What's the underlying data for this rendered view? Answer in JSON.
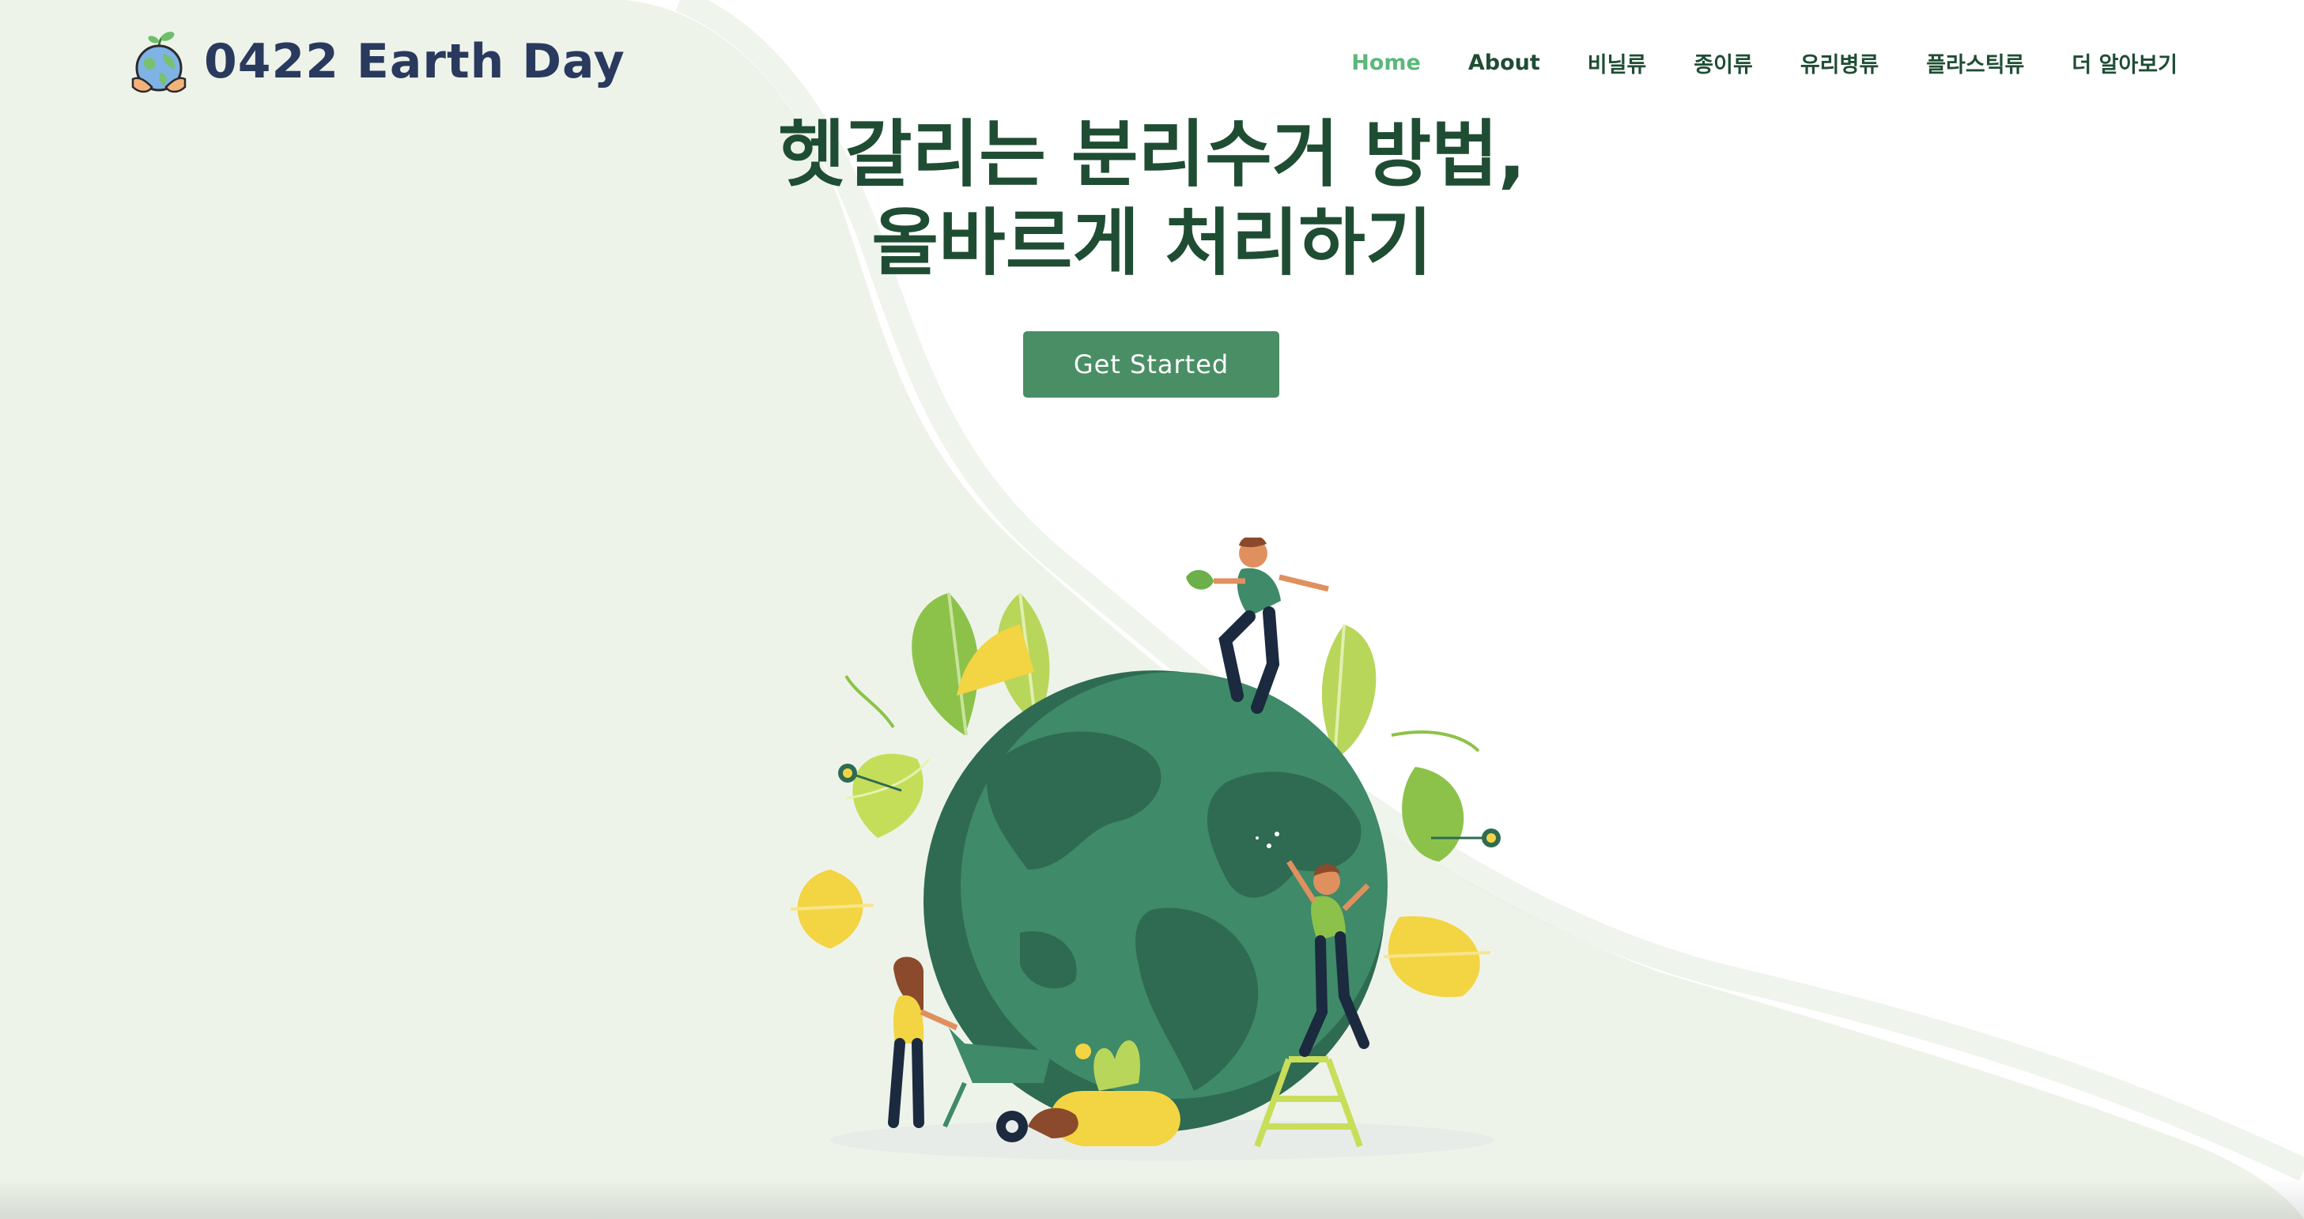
{
  "header": {
    "brand": "0422 Earth Day",
    "nav": [
      {
        "label": "Home",
        "active": true
      },
      {
        "label": "About",
        "active": false
      },
      {
        "label": "비닐류",
        "active": false
      },
      {
        "label": "종이류",
        "active": false
      },
      {
        "label": "유리병류",
        "active": false
      },
      {
        "label": "플라스틱류",
        "active": false
      },
      {
        "label": "더 알아보기",
        "active": false
      }
    ]
  },
  "hero": {
    "title_line1": "헷갈리는 분리수거 방법,",
    "title_line2": "올바르게 처리하기",
    "cta_label": "Get Started"
  },
  "colors": {
    "primary_dark": "#1f4d33",
    "accent_green": "#5cb77a",
    "button": "#4a8e66",
    "brand_text": "#2a3a5e",
    "background_wave": "#eef3ea"
  },
  "icons": {
    "logo": "earth-in-hands-icon"
  }
}
